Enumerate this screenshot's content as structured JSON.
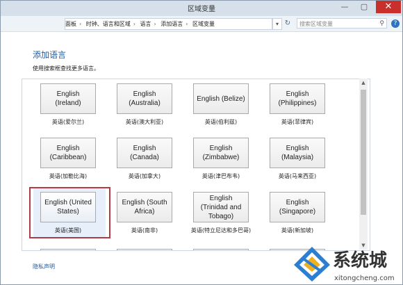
{
  "window": {
    "title": "区域变量"
  },
  "titlebar_buttons": {
    "minimize": "—",
    "maximize": "▢",
    "close": "✕"
  },
  "address": {
    "breadcrumbs": [
      "面板",
      "时钟、语言和区域",
      "语言",
      "添加语言",
      "区域变量"
    ],
    "separator": "›",
    "dropdown": "▾",
    "refresh": "↻"
  },
  "search": {
    "placeholder": "搜索区域变量"
  },
  "help": {
    "label": "?"
  },
  "content": {
    "title": "添加语言",
    "subtitle": "使用搜索框查找更多语言。",
    "tiles": [
      {
        "label": "English (Ireland)",
        "caption": "英语(爱尔兰)"
      },
      {
        "label": "English (Australia)",
        "caption": "英语(澳大利亚)"
      },
      {
        "label": "English (Belize)",
        "caption": "英语(伯利兹)"
      },
      {
        "label": "English (Philippines)",
        "caption": "英语(菲律宾)"
      },
      {
        "label": "English (Caribbean)",
        "caption": "英语(加勒比海)"
      },
      {
        "label": "English (Canada)",
        "caption": "英语(加拿大)"
      },
      {
        "label": "English (Zimbabwe)",
        "caption": "英语(津巴布韦)"
      },
      {
        "label": "English (Malaysia)",
        "caption": "英语(马来西亚)"
      },
      {
        "label": "English (United States)",
        "caption": "英语(美国)",
        "selected": true
      },
      {
        "label": "English (South Africa)",
        "caption": "英语(南非)"
      },
      {
        "label": "English (Trinidad and Tobago)",
        "caption": "英语(特立尼达和多巴哥)"
      },
      {
        "label": "English (Singapore)",
        "caption": "英语(新加坡)"
      }
    ]
  },
  "footer": {
    "privacy_link": "隐私声明"
  },
  "watermark": {
    "text": "系统城",
    "url": "xitongcheng.com"
  },
  "colors": {
    "accent": "#1e5ba8",
    "selection": "#b23b45",
    "close": "#c9302c"
  }
}
